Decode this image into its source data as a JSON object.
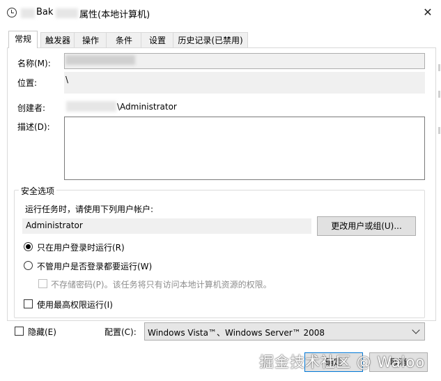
{
  "window": {
    "title_prefix": "Bak",
    "title_suffix": "属性(本地计算机)"
  },
  "tabs": [
    "常规",
    "触发器",
    "操作",
    "条件",
    "设置",
    "历史记录(已禁用)"
  ],
  "general": {
    "name_label": "名称(M):",
    "location_label": "位置:",
    "location_value": "\\",
    "author_label": "创建者:",
    "author_value": "\\Administrator",
    "description_label": "描述(D):"
  },
  "security": {
    "legend": "安全选项",
    "run_as_label": "运行任务时，请使用下列用户帐户:",
    "run_as_value": "Administrator",
    "change_user_button": "更改用户或组(U)...",
    "radio_logged_on": "只在用户登录时运行(R)",
    "radio_any": "不管用户是否登录都要运行(W)",
    "no_store_password": "不存储密码(P)。该任务将只有访问本地计算机资源的权限。",
    "highest_privileges": "使用最高权限运行(I)"
  },
  "bottom": {
    "hidden_label": "隐藏(E)",
    "configure_label": "配置(C):",
    "configure_value": "Windows Vista™、Windows Server™ 2008",
    "ok_button": "确定",
    "cancel_button": "取消"
  },
  "watermark": "掘金技术社区 @ Waloo"
}
